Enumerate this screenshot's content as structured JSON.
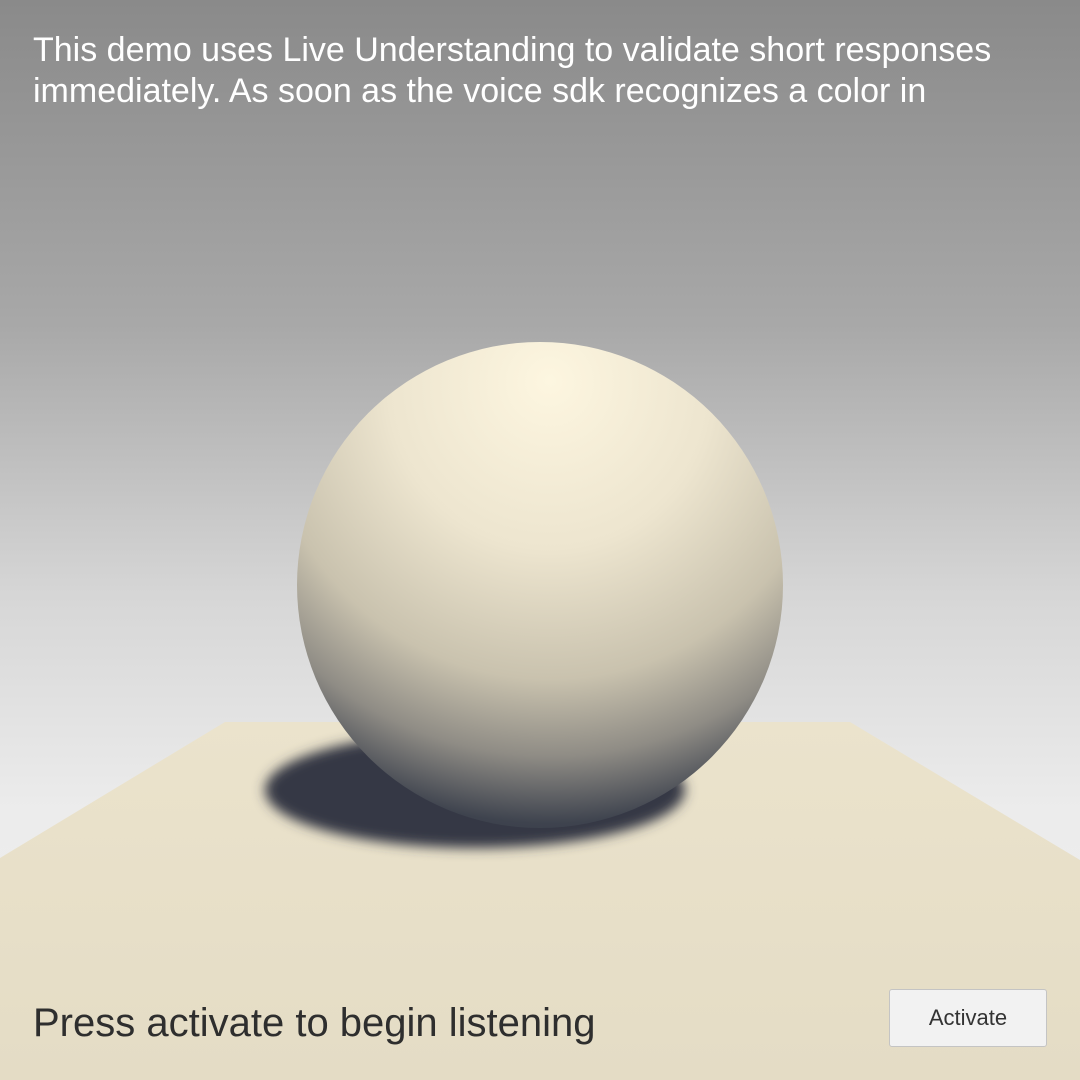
{
  "header": {
    "instructions": "This demo uses Live Understanding to validate short responses\nimmediately.  As soon as the voice sdk recognizes a color in"
  },
  "scene": {
    "objects": [
      "sphere",
      "floor-plane",
      "sphere-shadow"
    ],
    "colors": {
      "sky_top": "#8a8a8a",
      "sky_bottom": "#f0f0f0",
      "sphere_highlight": "#fdf6e0",
      "sphere_mid": "#d6d0bd",
      "sphere_dark": "#3a3f4a",
      "floor": "#e6dfc8",
      "shadow": "#343945"
    }
  },
  "footer": {
    "status": "Press activate to begin listening",
    "activate_label": "Activate"
  }
}
